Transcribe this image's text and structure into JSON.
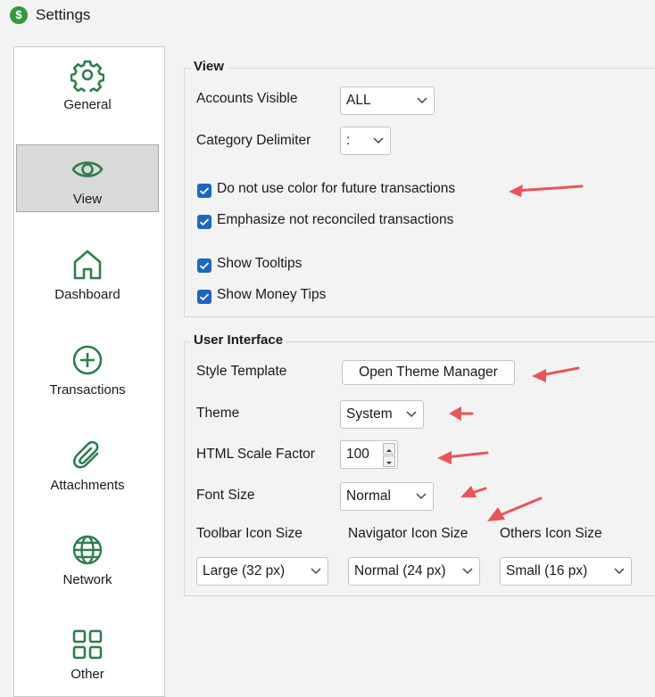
{
  "window": {
    "title": "Settings",
    "icon": "dollar-app-icon"
  },
  "colors": {
    "accent": "#1f66c1",
    "annotation": "#e8555b",
    "icon_green": "#2e7d4f"
  },
  "sidebar": {
    "items": [
      {
        "label": "General",
        "icon": "gear-icon"
      },
      {
        "label": "View",
        "icon": "eye-icon",
        "selected": true
      },
      {
        "label": "Dashboard",
        "icon": "home-icon"
      },
      {
        "label": "Transactions",
        "icon": "plus-circle-icon"
      },
      {
        "label": "Attachments",
        "icon": "paperclip-icon"
      },
      {
        "label": "Network",
        "icon": "globe-icon"
      },
      {
        "label": "Other",
        "icon": "grid-icon"
      }
    ]
  },
  "view_group": {
    "title": "View",
    "accounts_visible": {
      "label": "Accounts Visible",
      "value": "ALL"
    },
    "category_delimiter": {
      "label": "Category Delimiter",
      "value": ":"
    },
    "checkboxes": [
      {
        "label": "Do not use color for future transactions",
        "checked": true
      },
      {
        "label": "Emphasize not reconciled transactions",
        "checked": true
      },
      {
        "label": "Show Tooltips",
        "checked": true
      },
      {
        "label": "Show Money Tips",
        "checked": true
      }
    ]
  },
  "ui_group": {
    "title": "User Interface",
    "style_template": {
      "label": "Style Template",
      "button": "Open Theme Manager"
    },
    "theme": {
      "label": "Theme",
      "value": "System"
    },
    "html_scale": {
      "label": "HTML Scale Factor",
      "value": "100"
    },
    "font_size": {
      "label": "Font Size",
      "value": "Normal"
    },
    "toolbar_icon": {
      "label": "Toolbar Icon Size",
      "value": "Large (32 px)"
    },
    "navigator_icon": {
      "label": "Navigator Icon Size",
      "value": "Normal (24 px)"
    },
    "others_icon": {
      "label": "Others Icon Size",
      "value": "Small (16 px)"
    }
  }
}
